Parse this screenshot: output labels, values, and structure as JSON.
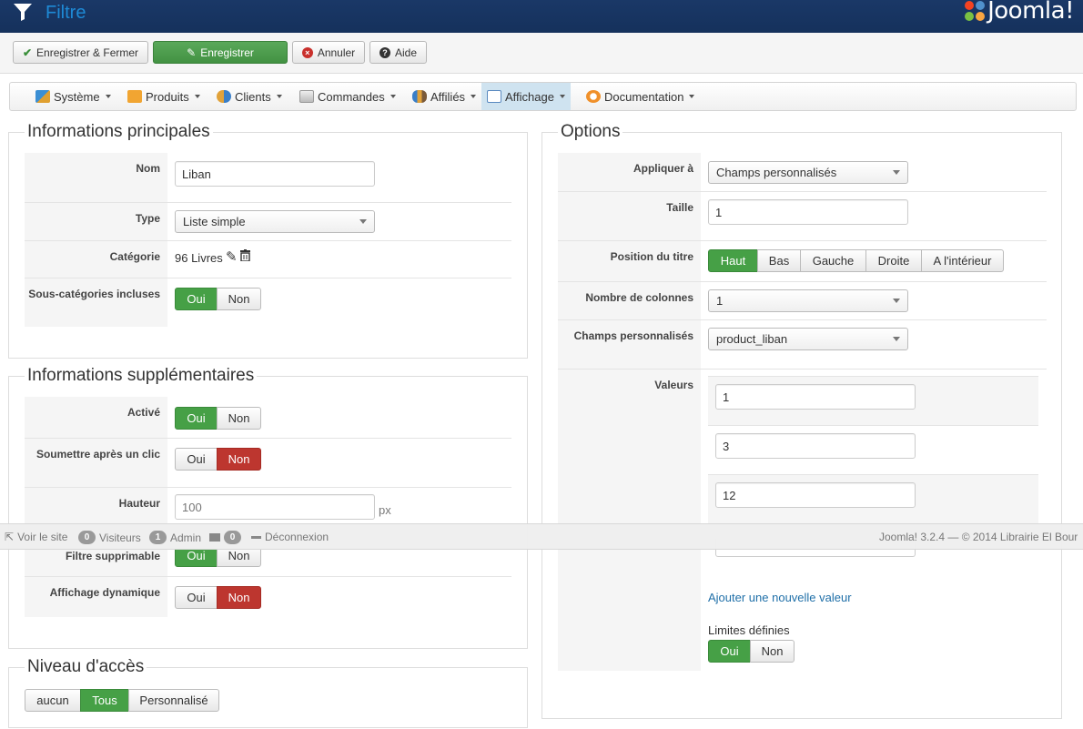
{
  "header": {
    "title": "Filtre",
    "logo_text": "Joomla!"
  },
  "toolbar": {
    "save_close": "Enregistrer & Fermer",
    "save": "Enregistrer",
    "cancel": "Annuler",
    "help": "Aide"
  },
  "nav": [
    {
      "label": "Système",
      "icon": "tools-icon"
    },
    {
      "label": "Produits",
      "icon": "box-icon"
    },
    {
      "label": "Clients",
      "icon": "users-icon"
    },
    {
      "label": "Commandes",
      "icon": "orders-icon"
    },
    {
      "label": "Affiliés",
      "icon": "affiliates-icon"
    },
    {
      "label": "Affichage",
      "icon": "display-icon"
    },
    {
      "label": "Documentation",
      "icon": "lifebuoy-icon"
    }
  ],
  "main_info": {
    "legend": "Informations principales",
    "name_label": "Nom",
    "name_value": "Liban",
    "type_label": "Type",
    "type_value": "Liste simple",
    "category_label": "Catégorie",
    "category_value": "96 Livres",
    "subcat_label": "Sous-catégories incluses",
    "yes": "Oui",
    "no": "Non"
  },
  "extra_info": {
    "legend": "Informations supplémentaires",
    "active_label": "Activé",
    "submit_label": "Soumettre après un clic",
    "height_label": "Hauteur",
    "height_value": "100",
    "height_unit": "px",
    "deletable_label": "Filtre supprimable",
    "dynamic_label": "Affichage dynamique",
    "yes": "Oui",
    "no": "Non"
  },
  "access": {
    "legend": "Niveau d'accès",
    "none": "aucun",
    "all": "Tous",
    "custom": "Personnalisé"
  },
  "options": {
    "legend": "Options",
    "apply_label": "Appliquer à",
    "apply_value": "Champs personnalisés",
    "size_label": "Taille",
    "size_value": "1",
    "title_pos_label": "Position du titre",
    "pos_top": "Haut",
    "pos_bottom": "Bas",
    "pos_left": "Gauche",
    "pos_right": "Droite",
    "pos_inside": "A l'intérieur",
    "columns_label": "Nombre de colonnes",
    "columns_value": "1",
    "fields_label": "Champs personnalisés",
    "fields_value": "product_liban",
    "values_label": "Valeurs",
    "values": [
      "1",
      "3",
      "12"
    ],
    "add_value": "Ajouter une nouvelle valeur",
    "limits_label": "Limites définies",
    "yes": "Oui",
    "no": "Non"
  },
  "statusbar": {
    "view_site": "Voir le site",
    "visitors_count": "0",
    "visitors": "Visiteurs",
    "admin_count": "1",
    "admin": "Admin",
    "messages_count": "0",
    "logout": "Déconnexion",
    "footer": "Joomla! 3.2.4  —  © 2014 Librairie El Bour"
  },
  "colors": {
    "header_bg": "#15315c",
    "success": "#46a046",
    "danger": "#bd362f",
    "link": "#1f6fa8"
  }
}
